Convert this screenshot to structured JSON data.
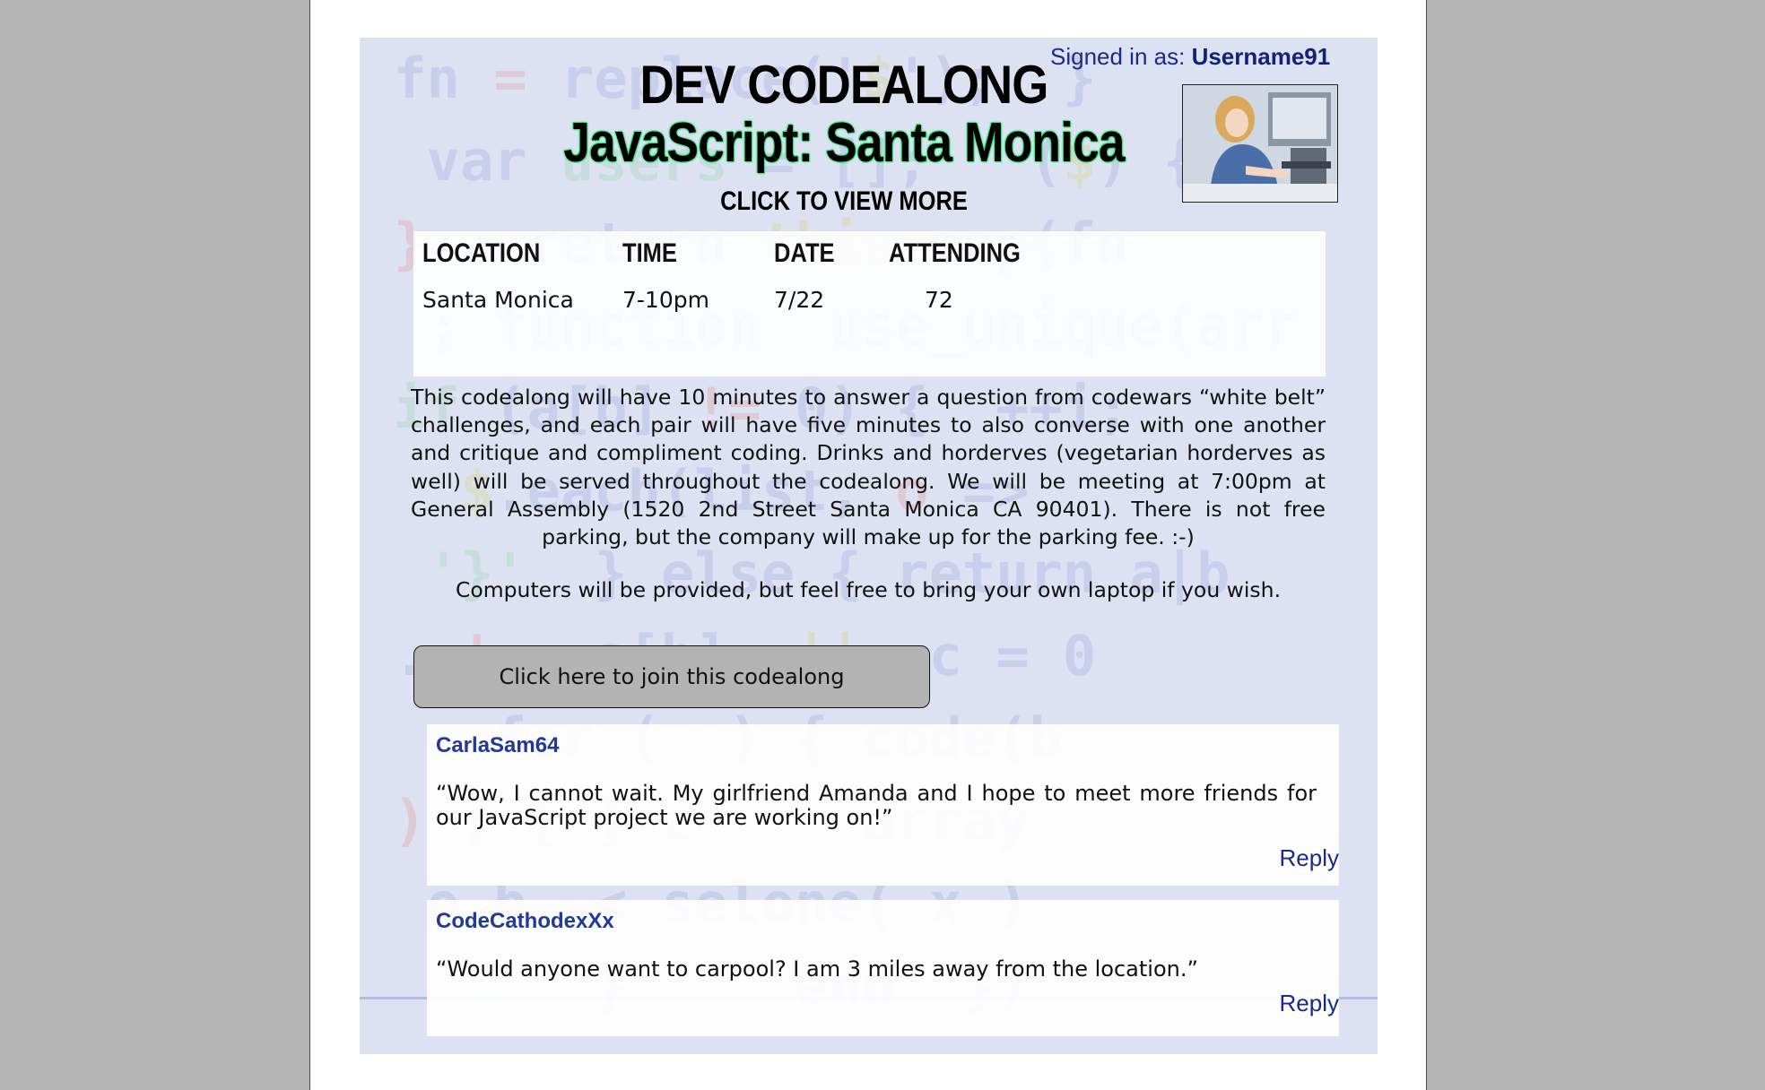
{
  "header": {
    "signed_in_label": "Signed in as:",
    "username": "Username91",
    "title": "DEV CODEALONG",
    "subtitle": "JavaScript: Santa Monica",
    "view_more": "CLICK TO VIEW MORE"
  },
  "event_table": {
    "headers": [
      "LOCATION",
      "TIME",
      "DATE",
      "ATTENDING"
    ],
    "values": [
      "Santa Monica",
      "7-10pm",
      "7/22",
      "72"
    ]
  },
  "description": {
    "main": "This codealong will have 10 minutes to answer a question from codewars “white belt” challenges, and each pair will have five minutes to also converse with one another and critique and compliment coding. Drinks and horderves (vegetarian horderves as well) will be served throughout the codealong. We will be meeting at 7:00pm at General Assembly (1520 2nd Street Santa Monica CA 90401). There is not free parking, but the company will make up for the parking fee. :-)",
    "note": "Computers will be provided, but feel free to bring your own laptop if you wish."
  },
  "join_button": "Click here to join this codealong",
  "comments": [
    {
      "author": "CarlaSam64",
      "text": "“Wow, I cannot wait. My girlfriend Amanda and I hope to meet more friends for our JavaScript project we are working on!”",
      "reply_label": "Reply"
    },
    {
      "author": "CodeCathodexXx",
      "text": "“Would anyone want to carpool? I am 3 miles away from the location.”",
      "reply_label": "Reply"
    }
  ],
  "colors": {
    "link": "#1a2a8c",
    "author": "#22399a",
    "title_glow": "#2ee87a",
    "button_bg": "#b3b3b3",
    "page_bg": "#b5b5b5"
  }
}
